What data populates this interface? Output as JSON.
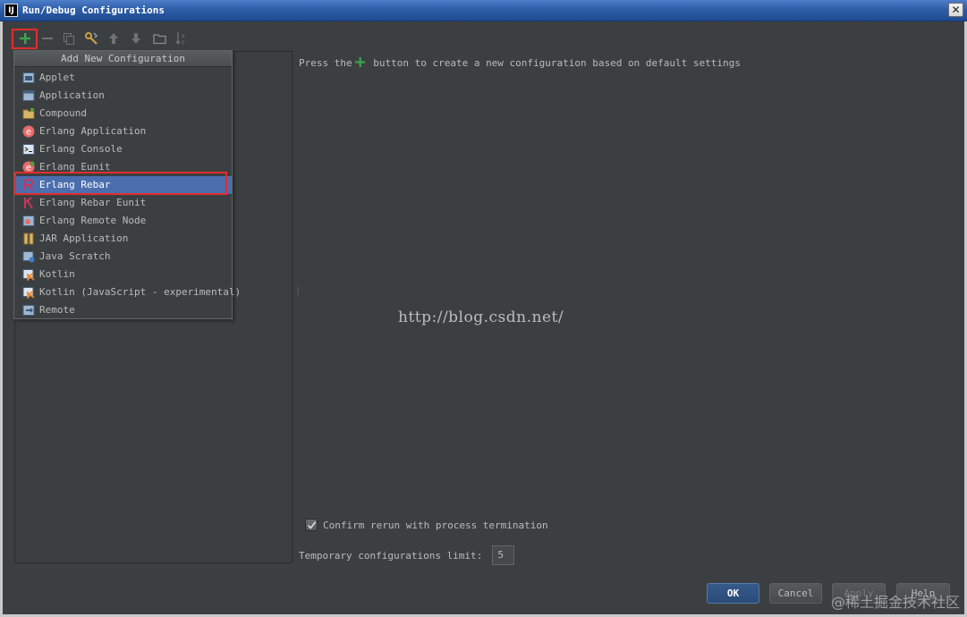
{
  "window": {
    "app_icon": "IJ",
    "title": "Run/Debug Configurations",
    "close_glyph": "✕"
  },
  "toolbar": {
    "buttons": [
      {
        "name": "add-icon",
        "color": "#3fa34d"
      },
      {
        "name": "remove-icon"
      },
      {
        "name": "copy-icon"
      },
      {
        "name": "edit-defaults-icon"
      },
      {
        "name": "move-up-icon"
      },
      {
        "name": "move-down-icon"
      },
      {
        "name": "folder-icon"
      },
      {
        "name": "sort-icon"
      }
    ]
  },
  "popup": {
    "header": "Add New Configuration",
    "items": [
      {
        "label": "Applet",
        "icon": "applet-icon"
      },
      {
        "label": "Application",
        "icon": "application-icon"
      },
      {
        "label": "Compound",
        "icon": "compound-icon"
      },
      {
        "label": "Erlang Application",
        "icon": "erlang-icon"
      },
      {
        "label": "Erlang Console",
        "icon": "console-icon"
      },
      {
        "label": "Erlang Eunit",
        "icon": "erlang-eunit-icon"
      },
      {
        "label": "Erlang Rebar",
        "icon": "rebar-icon",
        "selected": true
      },
      {
        "label": "Erlang Rebar Eunit",
        "icon": "rebar-eunit-icon"
      },
      {
        "label": "Erlang Remote Node",
        "icon": "remote-node-icon"
      },
      {
        "label": "JAR Application",
        "icon": "jar-icon"
      },
      {
        "label": "Java Scratch",
        "icon": "java-scratch-icon"
      },
      {
        "label": "Kotlin",
        "icon": "kotlin-icon"
      },
      {
        "label": "Kotlin (JavaScript - experimental)",
        "icon": "kotlin-js-icon"
      },
      {
        "label": "Remote",
        "icon": "remote-icon"
      }
    ]
  },
  "main": {
    "hint_before": "Press the",
    "hint_after": "button to create a new configuration based on default settings",
    "watermark_url": "http://blog.csdn.net/",
    "confirm_label": "Confirm rerun with process termination",
    "confirm_checked": true,
    "limit_label": "Temporary configurations limit:",
    "limit_value": "5"
  },
  "buttons": {
    "ok": "OK",
    "cancel": "Cancel",
    "apply": "Apply",
    "help": "Help"
  },
  "brand_watermark": "@稀土掘金技术社区",
  "colors": {
    "background": "#3c3f41",
    "selection": "#4b6eaf",
    "highlight_outline": "#e22d2d",
    "add_green": "#3fa34d"
  }
}
